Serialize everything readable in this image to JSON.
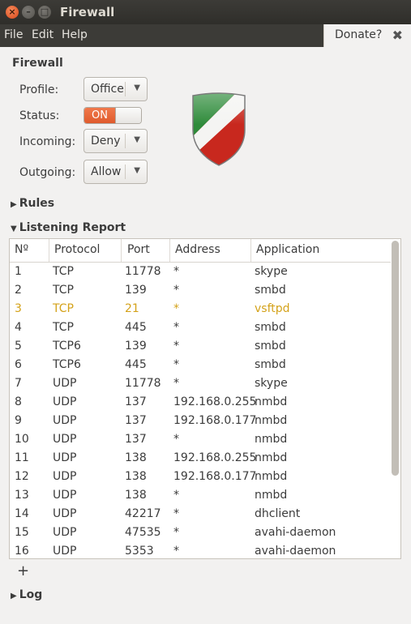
{
  "window": {
    "title": "Firewall",
    "close_glyph": "×",
    "min_glyph": "–",
    "max_glyph": "□"
  },
  "menubar": {
    "items": [
      "File",
      "Edit",
      "Help"
    ],
    "donate_label": "Donate?",
    "donate_close_glyph": "✖"
  },
  "firewall": {
    "section_title": "Firewall",
    "profile_label": "Profile:",
    "profile_value": "Office",
    "status_label": "Status:",
    "status_value": "ON",
    "incoming_label": "Incoming:",
    "incoming_value": "Deny",
    "outgoing_label": "Outgoing:",
    "outgoing_value": "Allow",
    "shield_colors": [
      "#2e8b3a",
      "#ffffff",
      "#c8281e"
    ]
  },
  "rules": {
    "label": "Rules",
    "expanded": false
  },
  "report": {
    "label": "Listening Report",
    "expanded": true,
    "columns": [
      "Nº",
      "Protocol",
      "Port",
      "Address",
      "Application"
    ],
    "highlight_color": "#d4a21a",
    "rows": [
      {
        "n": "1",
        "protocol": "TCP",
        "port": "11778",
        "address": "*",
        "application": "skype",
        "highlight": false
      },
      {
        "n": "2",
        "protocol": "TCP",
        "port": "139",
        "address": "*",
        "application": "smbd",
        "highlight": false
      },
      {
        "n": "3",
        "protocol": "TCP",
        "port": "21",
        "address": "*",
        "application": "vsftpd",
        "highlight": true
      },
      {
        "n": "4",
        "protocol": "TCP",
        "port": "445",
        "address": "*",
        "application": "smbd",
        "highlight": false
      },
      {
        "n": "5",
        "protocol": "TCP6",
        "port": "139",
        "address": "*",
        "application": "smbd",
        "highlight": false
      },
      {
        "n": "6",
        "protocol": "TCP6",
        "port": "445",
        "address": "*",
        "application": "smbd",
        "highlight": false
      },
      {
        "n": "7",
        "protocol": "UDP",
        "port": "11778",
        "address": "*",
        "application": "skype",
        "highlight": false
      },
      {
        "n": "8",
        "protocol": "UDP",
        "port": "137",
        "address": "192.168.0.255",
        "application": "nmbd",
        "highlight": false
      },
      {
        "n": "9",
        "protocol": "UDP",
        "port": "137",
        "address": "192.168.0.177",
        "application": "nmbd",
        "highlight": false
      },
      {
        "n": "10",
        "protocol": "UDP",
        "port": "137",
        "address": "*",
        "application": "nmbd",
        "highlight": false
      },
      {
        "n": "11",
        "protocol": "UDP",
        "port": "138",
        "address": "192.168.0.255",
        "application": "nmbd",
        "highlight": false
      },
      {
        "n": "12",
        "protocol": "UDP",
        "port": "138",
        "address": "192.168.0.177",
        "application": "nmbd",
        "highlight": false
      },
      {
        "n": "13",
        "protocol": "UDP",
        "port": "138",
        "address": "*",
        "application": "nmbd",
        "highlight": false
      },
      {
        "n": "14",
        "protocol": "UDP",
        "port": "42217",
        "address": "*",
        "application": "dhclient",
        "highlight": false
      },
      {
        "n": "15",
        "protocol": "UDP",
        "port": "47535",
        "address": "*",
        "application": "avahi-daemon",
        "highlight": false
      },
      {
        "n": "16",
        "protocol": "UDP",
        "port": "5353",
        "address": "*",
        "application": "avahi-daemon",
        "highlight": false
      }
    ],
    "add_glyph": "+"
  },
  "log": {
    "label": "Log",
    "expanded": false
  }
}
